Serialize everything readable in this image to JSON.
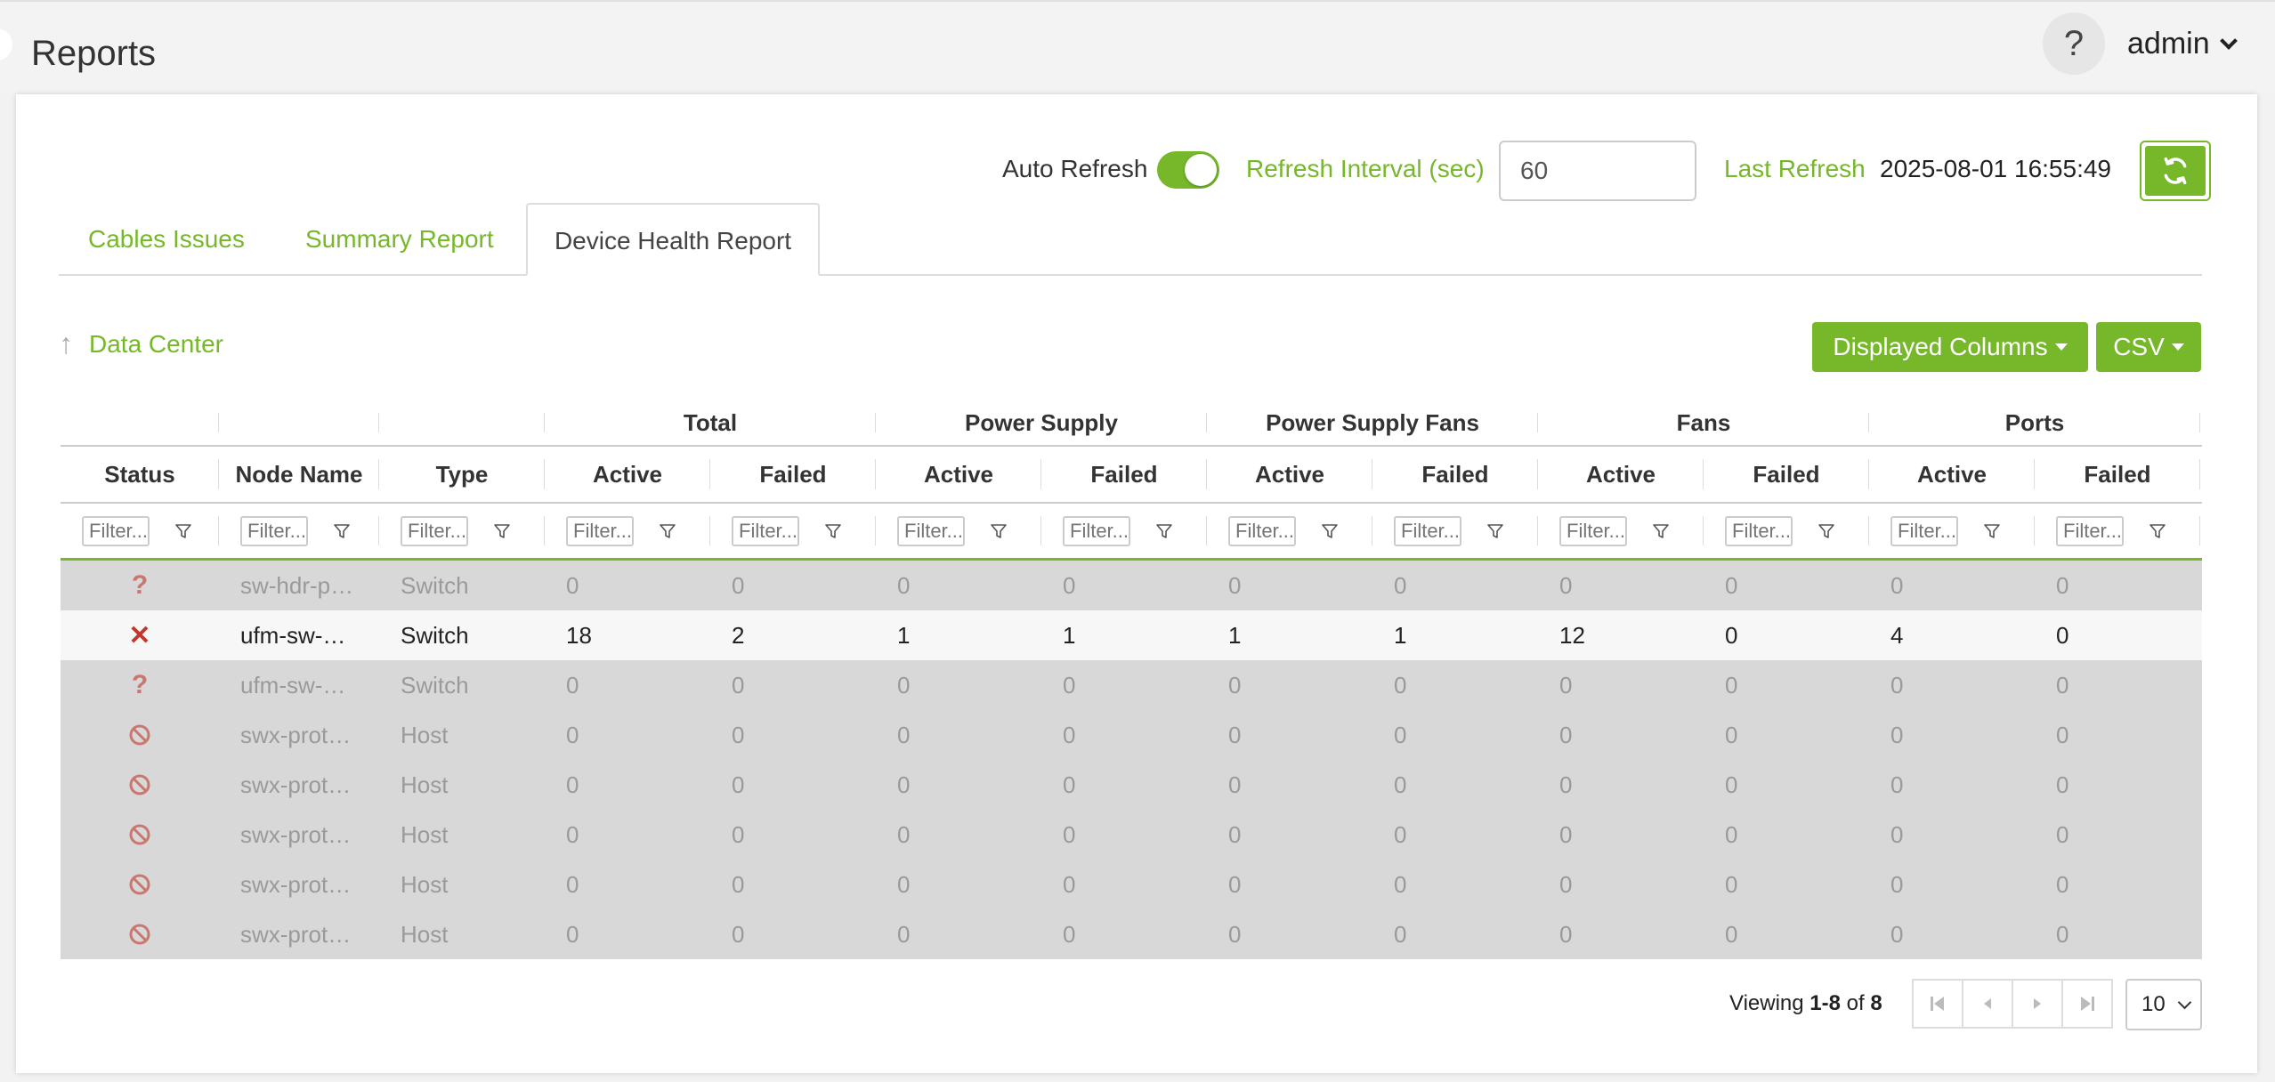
{
  "header": {
    "title": "Reports",
    "help_label": "?",
    "user_label": "admin"
  },
  "refresh": {
    "auto_label": "Auto Refresh",
    "auto_enabled": true,
    "interval_label": "Refresh Interval (sec)",
    "interval_value": "60",
    "last_label": "Last Refresh",
    "last_value": "2025-08-01 16:55:49"
  },
  "tabs": [
    {
      "label": "Cables Issues",
      "active": false
    },
    {
      "label": "Summary Report",
      "active": false
    },
    {
      "label": "Device Health Report",
      "active": true
    }
  ],
  "breadcrumb": {
    "label": "Data Center"
  },
  "buttons": {
    "displayed_columns": "Displayed Columns",
    "csv": "CSV"
  },
  "table": {
    "groups": [
      "Total",
      "Power Supply",
      "Power Supply Fans",
      "Fans",
      "Ports"
    ],
    "columns": [
      "Status",
      "Node Name",
      "Type",
      "Active",
      "Failed",
      "Active",
      "Failed",
      "Active",
      "Failed",
      "Active",
      "Failed",
      "Active",
      "Failed"
    ],
    "filter_placeholder": "Filter...",
    "rows": [
      {
        "status": "?",
        "name": "sw-hdr-p…",
        "type": "Switch",
        "values": [
          "0",
          "0",
          "0",
          "0",
          "0",
          "0",
          "0",
          "0",
          "0",
          "0"
        ],
        "active": false
      },
      {
        "status": "✕",
        "name": "ufm-sw-…",
        "type": "Switch",
        "values": [
          "18",
          "2",
          "1",
          "1",
          "1",
          "1",
          "12",
          "0",
          "4",
          "0"
        ],
        "active": true
      },
      {
        "status": "?",
        "name": "ufm-sw-…",
        "type": "Switch",
        "values": [
          "0",
          "0",
          "0",
          "0",
          "0",
          "0",
          "0",
          "0",
          "0",
          "0"
        ],
        "active": false
      },
      {
        "status": "⃠",
        "name": "swx-prot…",
        "type": "Host",
        "values": [
          "0",
          "0",
          "0",
          "0",
          "0",
          "0",
          "0",
          "0",
          "0",
          "0"
        ],
        "active": false
      },
      {
        "status": "⃠",
        "name": "swx-prot…",
        "type": "Host",
        "values": [
          "0",
          "0",
          "0",
          "0",
          "0",
          "0",
          "0",
          "0",
          "0",
          "0"
        ],
        "active": false
      },
      {
        "status": "⃠",
        "name": "swx-prot…",
        "type": "Host",
        "values": [
          "0",
          "0",
          "0",
          "0",
          "0",
          "0",
          "0",
          "0",
          "0",
          "0"
        ],
        "active": false
      },
      {
        "status": "⃠",
        "name": "swx-prot…",
        "type": "Host",
        "values": [
          "0",
          "0",
          "0",
          "0",
          "0",
          "0",
          "0",
          "0",
          "0",
          "0"
        ],
        "active": false
      },
      {
        "status": "⃠",
        "name": "swx-prot…",
        "type": "Host",
        "values": [
          "0",
          "0",
          "0",
          "0",
          "0",
          "0",
          "0",
          "0",
          "0",
          "0"
        ],
        "active": false
      }
    ]
  },
  "pagination": {
    "viewing_prefix": "Viewing ",
    "range": "1-8",
    "of_label": " of ",
    "total": "8",
    "page_size": "10"
  },
  "colors": {
    "accent": "#76b82a",
    "error": "#c0392b",
    "unknown": "#c9776f"
  }
}
